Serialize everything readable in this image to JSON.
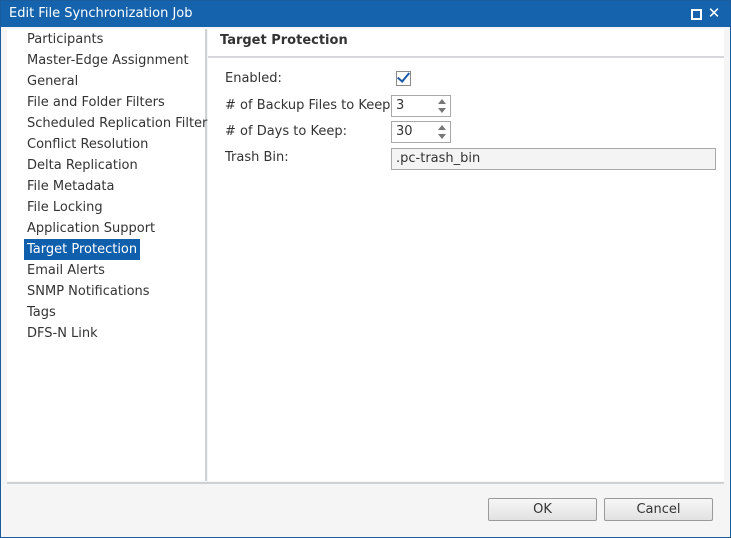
{
  "window": {
    "title": "Edit File Synchronization Job"
  },
  "sidebar": {
    "items": [
      {
        "label": "Participants",
        "active": false
      },
      {
        "label": "Master-Edge Assignment",
        "active": false
      },
      {
        "label": "General",
        "active": false
      },
      {
        "label": "File and Folder Filters",
        "active": false
      },
      {
        "label": "Scheduled Replication Filters",
        "active": false
      },
      {
        "label": "Conflict Resolution",
        "active": false
      },
      {
        "label": "Delta Replication",
        "active": false
      },
      {
        "label": "File Metadata",
        "active": false
      },
      {
        "label": "File Locking",
        "active": false
      },
      {
        "label": "Application Support",
        "active": false
      },
      {
        "label": "Target Protection",
        "active": true
      },
      {
        "label": "Email Alerts",
        "active": false
      },
      {
        "label": "SNMP Notifications",
        "active": false
      },
      {
        "label": "Tags",
        "active": false
      },
      {
        "label": "DFS-N Link",
        "active": false
      }
    ]
  },
  "panel": {
    "title": "Target Protection",
    "enabled": {
      "label": "Enabled:",
      "checked": true
    },
    "backup_files": {
      "label": "# of Backup Files to Keep:",
      "value": "3"
    },
    "days": {
      "label": "# of Days to Keep:",
      "value": "30"
    },
    "trash_bin": {
      "label": "Trash Bin:",
      "value": ".pc-trash_bin"
    }
  },
  "footer": {
    "ok_label": "OK",
    "cancel_label": "Cancel"
  },
  "colors": {
    "titlebar": "#1663ad",
    "selection": "#0f5fad"
  }
}
